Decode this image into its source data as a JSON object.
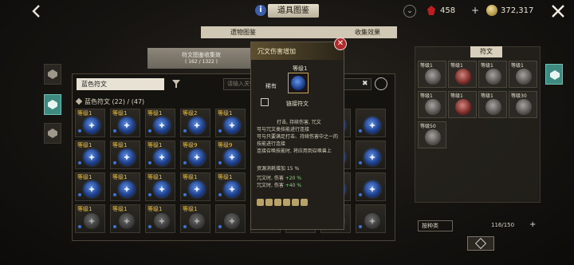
{
  "header": {
    "title": "道具图鉴",
    "ruby_count": "458",
    "gold_count": "372,317"
  },
  "tabs": {
    "collection": "遗物图鉴",
    "effect": "收集效果"
  },
  "collect_banner": {
    "line1": "符文图鉴收集效",
    "line2": "( 162 / 1322 )"
  },
  "filter": {
    "selected": "蓝色符文",
    "search_placeholder": "请输入关键"
  },
  "section": {
    "label": "蓝色符文 (22) / (47)"
  },
  "grid": [
    {
      "lv": "等级1",
      "dim": false
    },
    {
      "lv": "等级1",
      "dim": false
    },
    {
      "lv": "等级1",
      "dim": false
    },
    {
      "lv": "等级2",
      "dim": false
    },
    {
      "lv": "等级1",
      "dim": false
    },
    {
      "lv": "",
      "dim": false
    },
    {
      "lv": "",
      "dim": false
    },
    {
      "lv": "等级1",
      "dim": false
    },
    {
      "lv": "",
      "dim": false
    },
    {
      "lv": "等级1",
      "dim": false
    },
    {
      "lv": "等级1",
      "dim": false
    },
    {
      "lv": "等级1",
      "dim": false
    },
    {
      "lv": "等级9",
      "dim": false
    },
    {
      "lv": "等级9",
      "dim": false
    },
    {
      "lv": "等级1",
      "dim": false
    },
    {
      "lv": "",
      "dim": false
    },
    {
      "lv": "等级1",
      "dim": false
    },
    {
      "lv": "",
      "dim": false
    },
    {
      "lv": "等级1",
      "dim": false
    },
    {
      "lv": "等级1",
      "dim": false
    },
    {
      "lv": "等级1",
      "dim": false
    },
    {
      "lv": "等级1",
      "dim": false
    },
    {
      "lv": "等级1",
      "dim": false
    },
    {
      "lv": "等级1",
      "dim": false
    },
    {
      "lv": "",
      "dim": false
    },
    {
      "lv": "等级1",
      "dim": false
    },
    {
      "lv": "",
      "dim": false
    },
    {
      "lv": "等级1",
      "dim": true
    },
    {
      "lv": "等级1",
      "dim": true
    },
    {
      "lv": "等级1",
      "dim": true
    },
    {
      "lv": "等级1",
      "dim": true
    },
    {
      "lv": "",
      "dim": true
    },
    {
      "lv": "",
      "dim": true
    },
    {
      "lv": "",
      "dim": true
    },
    {
      "lv": "等级1",
      "dim": true
    },
    {
      "lv": "",
      "dim": true
    }
  ],
  "tooltip": {
    "title": "冗文伤害增加",
    "level": "等级1",
    "rarity": "稀有",
    "link": "链接符文",
    "desc_head": "打击, 持续伤害, 冗文",
    "desc1": "可与冗文类技能进行连接",
    "desc2": "可与只要满足打击、持续伤害中之一的技能进行连接",
    "desc3": "连接召唤技能时, 将应用到召唤兽上",
    "cost": "资源消耗增加 15 %",
    "stat1_label": "冗文时, 伤害",
    "stat1_value": "+20 %",
    "stat2_label": "冗文时, 伤害",
    "stat2_value": "+40 %"
  },
  "rune_panel": {
    "title": "符文",
    "slots": [
      {
        "lv": "等级1"
      },
      {
        "lv": "等级1"
      },
      {
        "lv": "等级1"
      },
      {
        "lv": "等级1"
      },
      {
        "lv": "等级1"
      },
      {
        "lv": "等级1"
      },
      {
        "lv": "等级1"
      },
      {
        "lv": "等级30"
      },
      {
        "lv": "等级50"
      }
    ],
    "sort_label": "按种类",
    "bag_count": "116/150"
  }
}
